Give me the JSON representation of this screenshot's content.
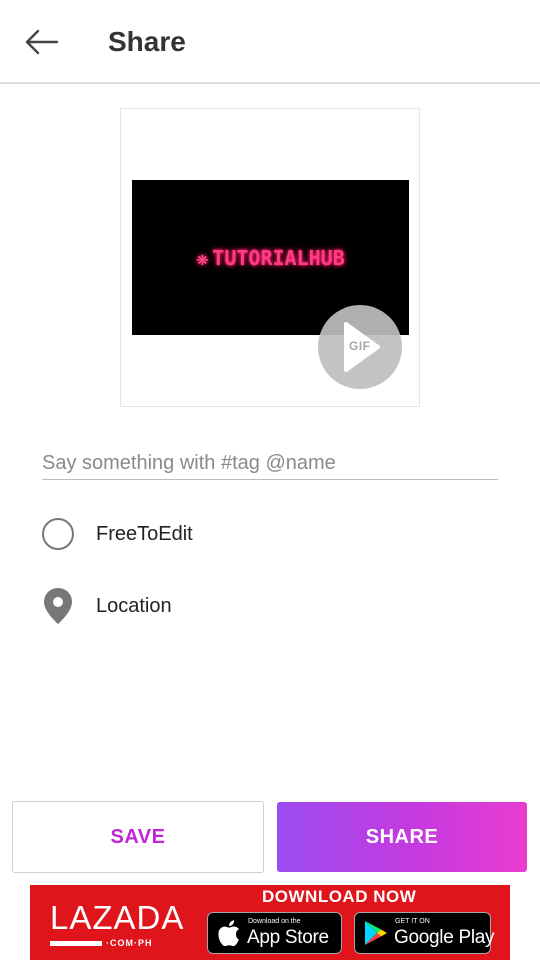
{
  "header": {
    "back_icon": "arrow-left-icon",
    "title": "Share"
  },
  "preview": {
    "brand_text": "TUTORIALHUB",
    "brand_icon": "flower-icon",
    "brand_color": "#ff3d86",
    "badge_label": "GIF",
    "badge_icon": "play-icon"
  },
  "caption": {
    "placeholder": "Say something with #tag @name",
    "value": ""
  },
  "options": {
    "free_to_edit": {
      "label": "FreeToEdit",
      "checked": false
    },
    "location": {
      "label": "Location",
      "icon": "location-pin-icon"
    }
  },
  "actions": {
    "save_label": "SAVE",
    "share_label": "SHARE",
    "save_color": "#c025d8",
    "share_gradient": [
      "#9a4cf0",
      "#e93dd0"
    ]
  },
  "ad": {
    "brand": "LAZADA",
    "brand_sub": "·COM·PH",
    "cta": "DOWNLOAD NOW",
    "background": "#e0141b",
    "app_store_small": "Download on the",
    "app_store_big": "App Store",
    "google_play_small": "GET IT ON",
    "google_play_big": "Google Play"
  }
}
